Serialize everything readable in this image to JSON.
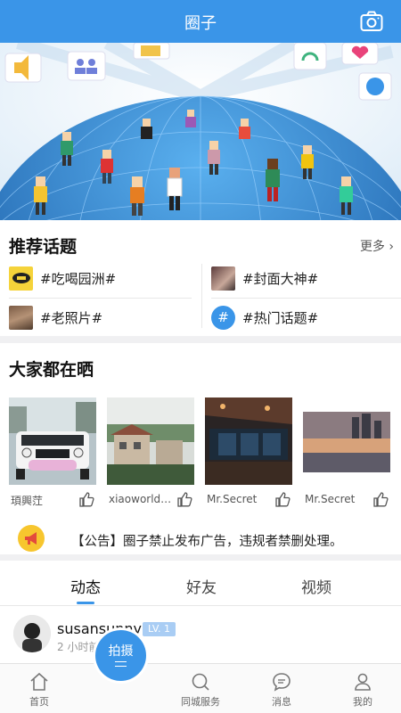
{
  "header": {
    "title": "圈子",
    "camera_icon": "camera-icon"
  },
  "topics": {
    "title": "推荐话题",
    "more": "更多",
    "items": [
      {
        "label": "#吃喝园洲#",
        "thumb": "food-logo-thumb"
      },
      {
        "label": "#封面大神#",
        "thumb": "cover-photo-thumb"
      },
      {
        "label": "#老照片#",
        "thumb": "old-photo-thumb"
      },
      {
        "label": "#热门话题#",
        "thumb": "hash-icon"
      }
    ]
  },
  "gallery": {
    "title": "大家都在晒",
    "items": [
      {
        "user": "頊興茳",
        "image": "white-suv-photo"
      },
      {
        "user": "xiaoworld1...",
        "image": "villa-photo"
      },
      {
        "user": "Mr.Secret",
        "image": "dark-interior-photo"
      },
      {
        "user": "Mr.Secret",
        "image": "lake-sunset-photo"
      }
    ]
  },
  "notice": {
    "text": "【公告】圈子禁止发布广告，违规者禁删处理。"
  },
  "tabs": [
    {
      "label": "动态",
      "active": true
    },
    {
      "label": "好友",
      "active": false
    },
    {
      "label": "视频",
      "active": false
    }
  ],
  "post": {
    "username": "susansunny",
    "level": "LV. 1",
    "time": "2 小时前"
  },
  "bottom_nav": {
    "fab_label": "拍摄",
    "items": [
      {
        "label": "首页",
        "icon": "home-icon"
      },
      {
        "label": "同城服务",
        "icon": "search-icon"
      },
      {
        "label": "消息",
        "icon": "message-icon"
      },
      {
        "label": "我的",
        "icon": "user-icon"
      }
    ]
  },
  "colors": {
    "primary": "#3a95e8",
    "notice_icon": "#f7c62e",
    "level_badge": "#a9cdf4"
  }
}
